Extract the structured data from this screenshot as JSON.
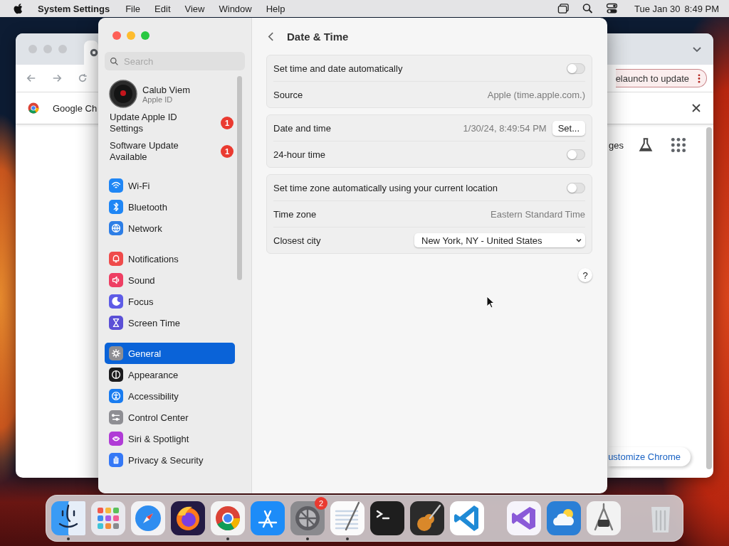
{
  "menubar": {
    "app_name": "System Settings",
    "menus": [
      "File",
      "Edit",
      "View",
      "Window",
      "Help"
    ],
    "date": "Tue Jan 30",
    "time": "8:49 PM"
  },
  "browser_window": {
    "tab_text": "Google Ch",
    "update_pill": "elaunch to update",
    "shortcut_text": "ges",
    "customize_button": "ustomize Chrome"
  },
  "settings_window": {
    "search": {
      "placeholder": "Search"
    },
    "profile": {
      "name": "Calub Viem",
      "subtitle": "Apple ID"
    },
    "notices": [
      {
        "text": "Update Apple ID Settings",
        "badge": "1"
      },
      {
        "text": "Software Update Available",
        "badge": "1"
      }
    ],
    "sidebar_groups": [
      [
        {
          "label": "Wi-Fi",
          "color": "#1f86f5",
          "selected": false
        },
        {
          "label": "Bluetooth",
          "color": "#1f86f5",
          "selected": false
        },
        {
          "label": "Network",
          "color": "#2d7ee6",
          "selected": false
        }
      ],
      [
        {
          "label": "Notifications",
          "color": "#ef4b4b",
          "selected": false
        },
        {
          "label": "Sound",
          "color": "#ee3f63",
          "selected": false
        },
        {
          "label": "Focus",
          "color": "#5e5ce6",
          "selected": false
        },
        {
          "label": "Screen Time",
          "color": "#5b50d6",
          "selected": false
        }
      ],
      [
        {
          "label": "General",
          "color": "#8e8e93",
          "selected": true
        },
        {
          "label": "Appearance",
          "color": "#1c1c1e",
          "selected": false
        },
        {
          "label": "Accessibility",
          "color": "#1a7cf0",
          "selected": false
        },
        {
          "label": "Control Center",
          "color": "#8e8e93",
          "selected": false
        },
        {
          "label": "Siri & Spotlight",
          "color": "#b03bd6",
          "selected": false
        },
        {
          "label": "Privacy & Security",
          "color": "#3478f6",
          "selected": false
        }
      ]
    ],
    "page_title": "Date & Time",
    "groups": [
      [
        {
          "kind": "toggle",
          "label": "Set time and date automatically",
          "on": false
        },
        {
          "kind": "value",
          "label": "Source",
          "value": "Apple (time.apple.com.)"
        }
      ],
      [
        {
          "kind": "button",
          "label": "Date and time",
          "value": "1/30/24, 8:49:54 PM",
          "button": "Set..."
        },
        {
          "kind": "toggle",
          "label": "24-hour time",
          "on": false
        }
      ],
      [
        {
          "kind": "toggle",
          "label": "Set time zone automatically using your current location",
          "on": false
        },
        {
          "kind": "value",
          "label": "Time zone",
          "value": "Eastern Standard Time"
        },
        {
          "kind": "dropdown",
          "label": "Closest city",
          "value": "New York, NY - United States"
        }
      ]
    ],
    "help_button": "?"
  },
  "dock": [
    {
      "running": true
    },
    {
      "running": false
    },
    {
      "running": false
    },
    {
      "running": false
    },
    {
      "running": true
    },
    {
      "running": false
    },
    {
      "running": true,
      "badge": "2"
    },
    {
      "running": true
    },
    {
      "running": false
    },
    {
      "running": false
    },
    {
      "running": false
    },
    {
      "kind": "divider"
    },
    {
      "running": false
    },
    {
      "running": false
    },
    {
      "running": false
    },
    {
      "kind": "divider"
    },
    {
      "running": false
    }
  ]
}
